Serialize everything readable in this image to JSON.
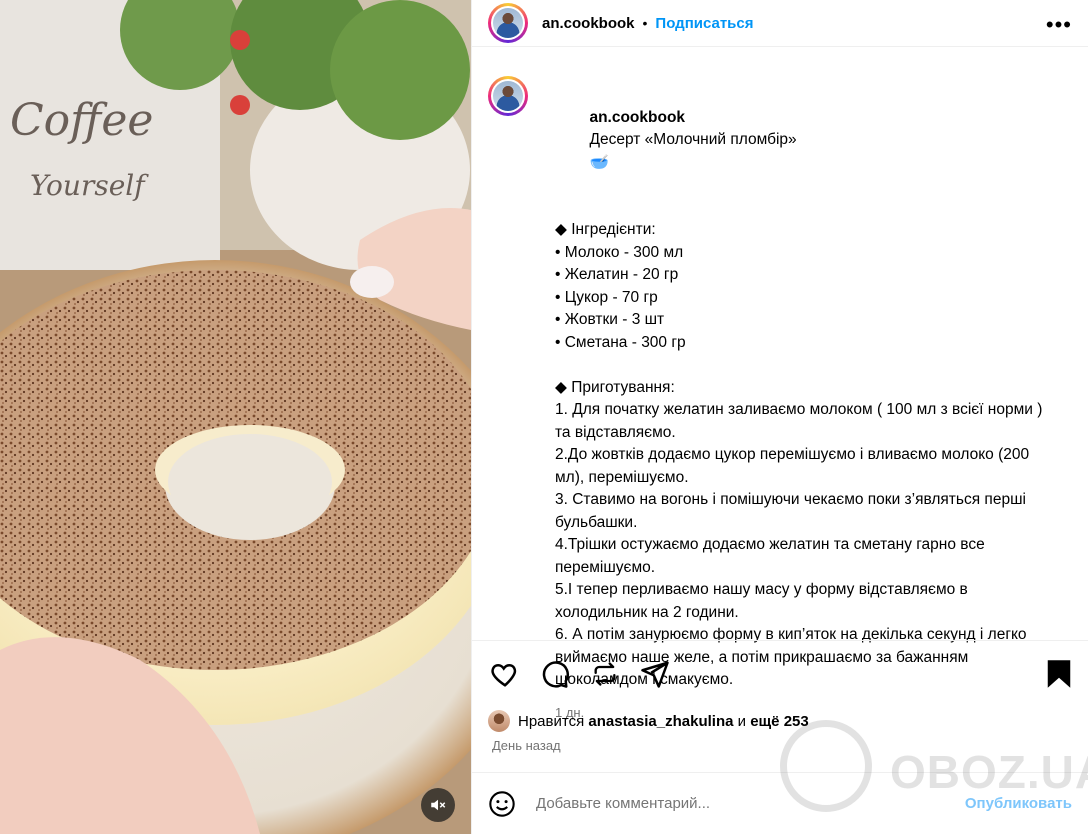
{
  "header": {
    "username": "an.cookbook",
    "separator": "•",
    "follow_label": "Подписаться",
    "more_label": "•••"
  },
  "caption": {
    "username": "an.cookbook",
    "title": "Десерт «Молочний пломбір»",
    "title_emoji": "🥣",
    "lines": [
      "",
      "◆ Інгредієнти:",
      "• Молоко - 300 мл",
      "• Желатин - 20 гр",
      "• Цукор - 70 гр",
      "• Жовтки - 3 шт",
      "• Сметана - 300 гр",
      "",
      "◆ Приготування:",
      "1. Для початку желатин заливаємо молоком ( 100 мл з всієї норми ) та відставляємо.",
      "2.До жовтків додаємо цукор перемішуємо і вливаємо молоко (200 мл), перемішуємо.",
      "3. Ставимо на вогонь і помішуючи чекаємо поки з’являться перші бульбашки.",
      "4.Трішки остужаємо додаємо желатин та сметану гарно все перемішуємо.",
      "5.І тепер перливаємо нашу масу у форму відставляємо в холодильник на 2 години.",
      "6. А потім занурюємо форму в кип’яток на декілька секунд і легко виймаємо наше желе, а потім прикрашаємо за бажанням шоколамдом і смакуємо."
    ],
    "time": "1 дн."
  },
  "likes": {
    "prefix": "Нравится",
    "user": "anastasia_zhakulina",
    "and": "и",
    "others": "ещё 253"
  },
  "date_ago": "День назад",
  "comment": {
    "placeholder": "Добавьте комментарий...",
    "post_label": "Опубликовать"
  },
  "watermark": {
    "text": "OBOZ.UA"
  },
  "icons": {
    "like": "heart-icon",
    "comment": "comment-icon",
    "share": "repost-icon",
    "send": "send-icon",
    "save": "bookmark-icon",
    "emoji": "emoji-icon",
    "mute": "muted-icon"
  }
}
